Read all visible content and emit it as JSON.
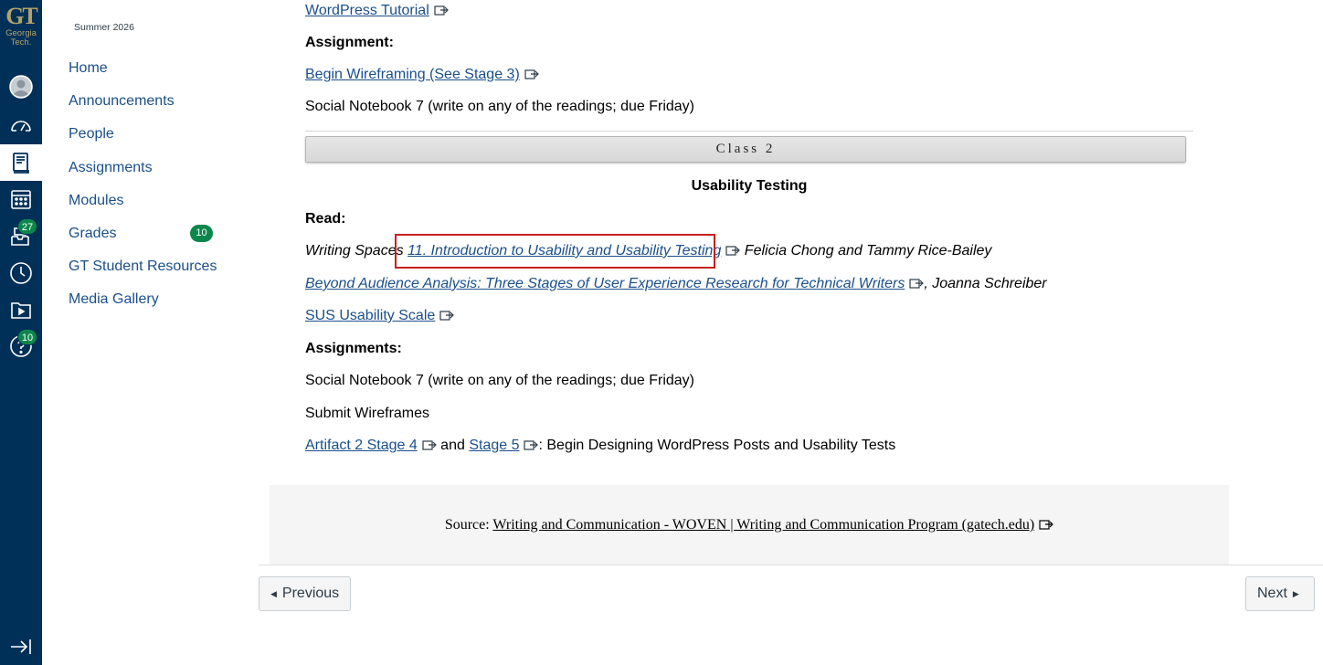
{
  "brand": {
    "logo_mark": "GT",
    "logo_line1": "Georgia",
    "logo_line2": "Tech.",
    "nav_bg": "#003057",
    "gold": "#b3a369",
    "link_color": "#1a4f8b",
    "badge_green": "#0b874b",
    "highlight_red": "#c81e1e"
  },
  "global_nav": {
    "items": [
      {
        "name": "account",
        "icon": "user-avatar-icon"
      },
      {
        "name": "dashboard",
        "icon": "dashboard-gauge-icon"
      },
      {
        "name": "courses",
        "icon": "courses-book-icon",
        "active": true
      },
      {
        "name": "calendar",
        "icon": "calendar-icon"
      },
      {
        "name": "inbox",
        "icon": "inbox-icon",
        "badge": "27"
      },
      {
        "name": "history",
        "icon": "clock-icon"
      },
      {
        "name": "studio",
        "icon": "studio-folder-icon"
      },
      {
        "name": "help",
        "icon": "help-icon",
        "badge": "10"
      }
    ],
    "collapse_icon": "collapse-arrow-icon"
  },
  "course_nav": {
    "term": "Summer 2026",
    "links": [
      {
        "label": "Home"
      },
      {
        "label": "Announcements"
      },
      {
        "label": "People"
      },
      {
        "label": "Assignments"
      },
      {
        "label": "Modules"
      },
      {
        "label": "Grades",
        "badge": "10"
      },
      {
        "label": "GT Student Resources"
      },
      {
        "label": "Media Gallery"
      }
    ]
  },
  "content": {
    "top_link": "WordPress Tutorial",
    "assignment_heading": "Assignment:",
    "wireframe_link": "Begin Wireframing (See Stage 3)",
    "notebook_prev": "Social Notebook 7 (write on any of the readings; due Friday)",
    "class_bar": "Class 2",
    "section_title": "Usability Testing",
    "read_heading": "Read:",
    "reading1_prefix": "Writing Spaces ",
    "reading1_link": "11. Introduction to Usability and Usability Testing",
    "reading1_suffix": " Felicia Chong and Tammy Rice-Bailey",
    "reading2_link": "Beyond Audience Analysis: Three Stages of User Experience Research for Technical Writers",
    "reading2_suffix": ", Joanna Schreiber",
    "reading3_link": "SUS Usability Scale",
    "assignments_heading": "Assignments:",
    "notebook": "Social Notebook 7 (write on any of the readings; due Friday)",
    "submit": "Submit Wireframes",
    "artifact_link1": "Artifact 2 Stage 4",
    "artifact_and": " and ",
    "artifact_link2": "Stage 5",
    "artifact_suffix": ": Begin Designing WordPress Posts and Usability Tests"
  },
  "source": {
    "label": "Source: ",
    "link": "Writing and Communication - WOVEN | Writing and Communication Program (gatech.edu)"
  },
  "pager": {
    "previous": "Previous",
    "next": "Next"
  }
}
